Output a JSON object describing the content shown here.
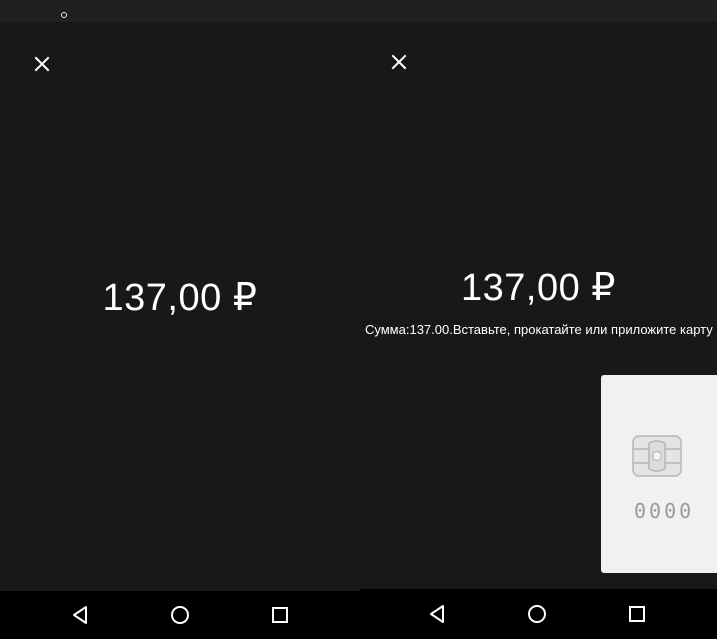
{
  "left_screen": {
    "amount": "137,00 ₽"
  },
  "right_screen": {
    "amount": "137,00 ₽",
    "prompt": "Сумма:137.00.Вставьте, прокатайте или приложите карту",
    "card": {
      "digits": "0000"
    }
  },
  "icons": {
    "close": "close-icon",
    "back": "back-triangle-icon",
    "home": "home-circle-icon",
    "recent": "recent-apps-square-icon",
    "chip": "card-chip-icon",
    "status": "notification-dot-icon"
  },
  "colors": {
    "background": "#181818",
    "status_bar": "#202020",
    "nav_bar": "#000000",
    "card": "#f1f1f1",
    "text": "#ffffff"
  }
}
